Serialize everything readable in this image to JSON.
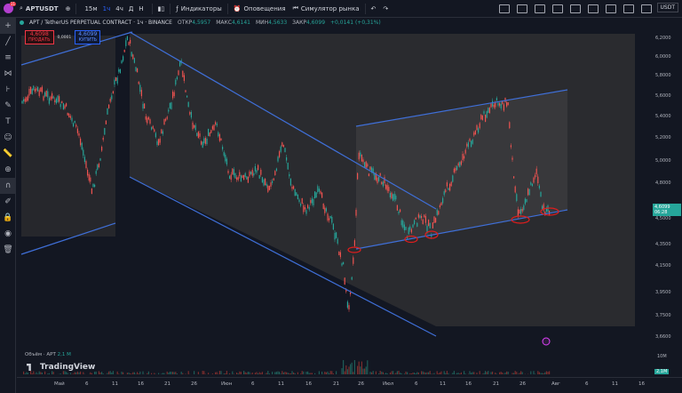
{
  "topbar": {
    "avatar_badge": "11",
    "symbol": "APTUSDT",
    "timeframes": [
      "15м",
      "1ч",
      "4ч",
      "Д",
      "Н"
    ],
    "active_timeframe": "1ч",
    "indicators_label": "Индикаторы",
    "alerts_label": "Оповещения",
    "replay_label": "Симулятор рынка",
    "currency": "USDT"
  },
  "legend": {
    "title": "APT / TetherUS PERPETUAL CONTRACT · 1ч · BINANCE",
    "open_label": "ОТКР",
    "open": "4,5957",
    "high_label": "МАКС",
    "high": "4,6141",
    "low_label": "МИН",
    "low": "4,5633",
    "close_label": "ЗАКР",
    "close": "4,6099",
    "change": "+0,0141 (+0,31%)"
  },
  "trade": {
    "sell_price": "4,6098",
    "sell_label": "ПРОДАТЬ",
    "spread": "0,0001",
    "buy_price": "4,6099",
    "buy_label": "КУПИТЬ"
  },
  "price_axis": {
    "ticks": [
      "6,2000",
      "6,0000",
      "5,8000",
      "5,6000",
      "5,4000",
      "5,2000",
      "5,0000",
      "4,8000",
      "4,5000",
      "4,3500",
      "4,1500",
      "3,9500",
      "3,7500",
      "3,6600"
    ],
    "current_price": "4,6099",
    "countdown": "06:28"
  },
  "volume": {
    "label": "Объём · APT",
    "value": "2,1 М",
    "axis_top": "10M",
    "axis_current": "2,1M"
  },
  "branding": {
    "logo_text": "TradingView"
  },
  "time_axis": {
    "labels": [
      "Май",
      "6",
      "11",
      "16",
      "21",
      "26",
      "Июн",
      "6",
      "11",
      "16",
      "21",
      "26",
      "Июл",
      "6",
      "11",
      "16",
      "21",
      "26",
      "Авг",
      "6",
      "11",
      "16"
    ]
  },
  "colors": {
    "up": "#26a69a",
    "down": "#ef5350",
    "channel": "#2962ff",
    "marker": "#e11d1d"
  }
}
